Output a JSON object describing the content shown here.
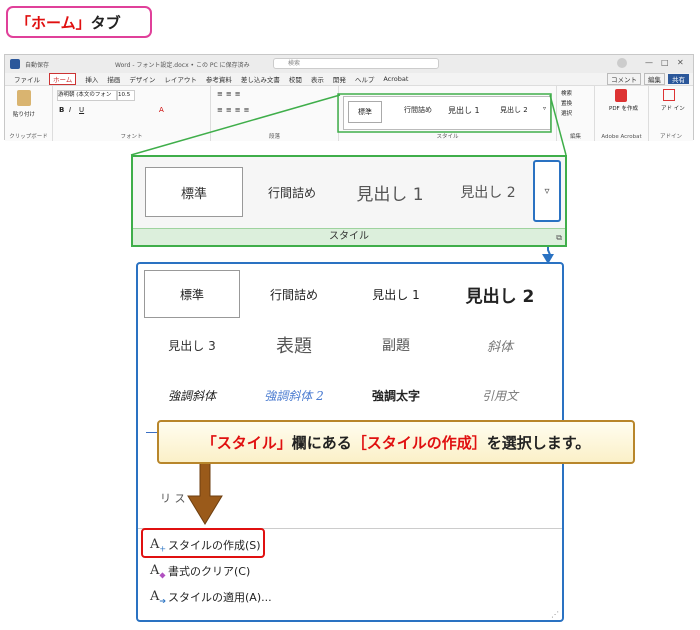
{
  "tab_label": {
    "quote_open": "「",
    "tab": "ホーム",
    "quote_close": "」",
    "suffix": "タブ"
  },
  "ribbon": {
    "titlebar": {
      "autosave": "自動保存",
      "doc_title": "Word - フォント設定.docx • この PC に保存済み",
      "search_placeholder": "検索"
    },
    "menu": [
      "ファイル",
      "ホーム",
      "挿入",
      "描画",
      "デザイン",
      "レイアウト",
      "参考資料",
      "差し込み文書",
      "校閲",
      "表示",
      "開発",
      "ヘルプ",
      "Acrobat"
    ],
    "active_tab": "ホーム",
    "right_buttons": {
      "comment": "コメント",
      "edit": "編集",
      "share": "共有"
    },
    "groups": {
      "clipboard": "クリップボード",
      "font": "フォント",
      "paragraph": "段落",
      "styles": "スタイル",
      "editing": "編集",
      "acrobat": "Adobe Acrobat",
      "addin": "アドイン"
    },
    "font_name": "游明朝 (本文のフォント",
    "font_size": "10.5",
    "paste": "貼り付け",
    "edit_items": [
      "検索",
      "置換",
      "選択"
    ],
    "pdf": "PDF を作成",
    "addin_label": "アド イン",
    "mini_styles": [
      "標準",
      "行間詰め",
      "見出し 1",
      "見出し 2"
    ]
  },
  "gallery": {
    "styles": [
      "標準",
      "行間詰め",
      "見出し 1",
      "見出し 2"
    ],
    "strip_label": "スタイル",
    "more_icon": "more-dropdown-icon"
  },
  "panel": {
    "row1": [
      "標準",
      "行間詰め",
      "見出し 1",
      "見出し 2"
    ],
    "row2": [
      "見出し 3",
      "表題",
      "副題",
      "斜体"
    ],
    "row3": [
      "強調斜体",
      "強調斜体 2",
      "強調太字",
      "引用文"
    ],
    "partial": "リ ス",
    "commands": [
      {
        "icon": "create-style-icon",
        "label": "スタイルの作成(S)"
      },
      {
        "icon": "clear-format-icon",
        "label": "書式のクリア(C)"
      },
      {
        "icon": "apply-style-icon",
        "label": "スタイルの適用(A)..."
      }
    ]
  },
  "callout": {
    "q1": "「",
    "t1": "スタイル",
    "q2": "」",
    "m1": "欄にある",
    "b1": "［",
    "t2": "スタイルの作成",
    "b2": "］",
    "m2": "を選択します。"
  },
  "colors": {
    "green": "#3fae4a",
    "blue": "#2a72c2",
    "red": "#e01010",
    "pink": "#e0409a",
    "brown": "#9a5a1a"
  }
}
